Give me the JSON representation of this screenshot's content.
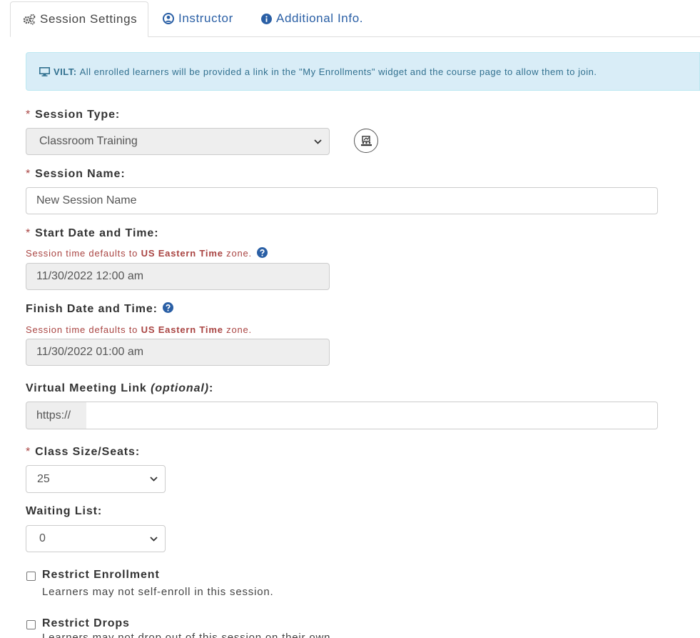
{
  "tabs": [
    {
      "label": "Session Settings",
      "icon": "gears-icon",
      "active": true
    },
    {
      "label": "Instructor",
      "icon": "user-circle-icon",
      "active": false
    },
    {
      "label": "Additional Info.",
      "icon": "info-circle-icon",
      "active": false
    }
  ],
  "alert": {
    "icon": "monitor-icon",
    "title": "VILT:",
    "text": "All enrolled learners will be provided a link in the \"My Enrollments\" widget and the course page to allow them to join."
  },
  "form": {
    "required_marker": "*",
    "session_type": {
      "label": "Session Type:",
      "value": "Classroom Training",
      "side_button_icon": "classroom-icon"
    },
    "session_name": {
      "label": "Session Name:",
      "value": "New Session Name"
    },
    "start": {
      "label": "Start Date and Time:",
      "hint_pre": "Session time defaults to",
      "hint_zone": "US Eastern Time",
      "hint_post": "zone.",
      "value": "11/30/2022 12:00 am"
    },
    "finish": {
      "label": "Finish Date and Time:",
      "hint_pre": "Session time defaults to",
      "hint_zone": "US Eastern Time",
      "hint_post": "zone.",
      "value": "11/30/2022 01:00 am"
    },
    "meeting_link": {
      "label": "Virtual Meeting Link",
      "optional": "(optional)",
      "colon": ":",
      "prefix": "https://",
      "value": ""
    },
    "class_size": {
      "label": "Class Size/Seats:",
      "value": "25"
    },
    "waiting_list": {
      "label": "Waiting List:",
      "value": "0"
    },
    "restrict_enrollment": {
      "label": "Restrict Enrollment",
      "desc": "Learners may not self-enroll in this session.",
      "checked": false
    },
    "restrict_drops": {
      "label": "Restrict Drops",
      "desc": "Learners may not drop out of this session on their own.",
      "checked": false
    }
  },
  "colors": {
    "link": "#2a5fa5",
    "required": "#a94442",
    "alert_bg": "#d9edf7",
    "alert_text": "#31708f"
  }
}
